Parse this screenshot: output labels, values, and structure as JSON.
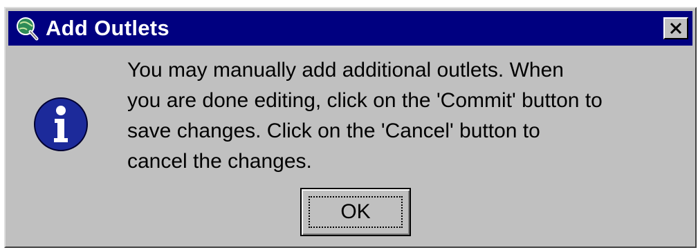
{
  "window": {
    "title": "Add Outlets",
    "icon": "globe-magnifier-icon",
    "close_icon": "close-x-icon"
  },
  "message": {
    "icon": "information-icon",
    "text": "You may manually add additional outlets.  When\nyou are done editing, click on the 'Commit' button to\nsave changes.   Click on the 'Cancel' button to\ncancel the changes."
  },
  "buttons": {
    "ok_label": "OK"
  },
  "colors": {
    "titlebar": "#000080",
    "dialog_face": "#c0c0c0",
    "info_icon_fill": "#1c2a9a"
  }
}
